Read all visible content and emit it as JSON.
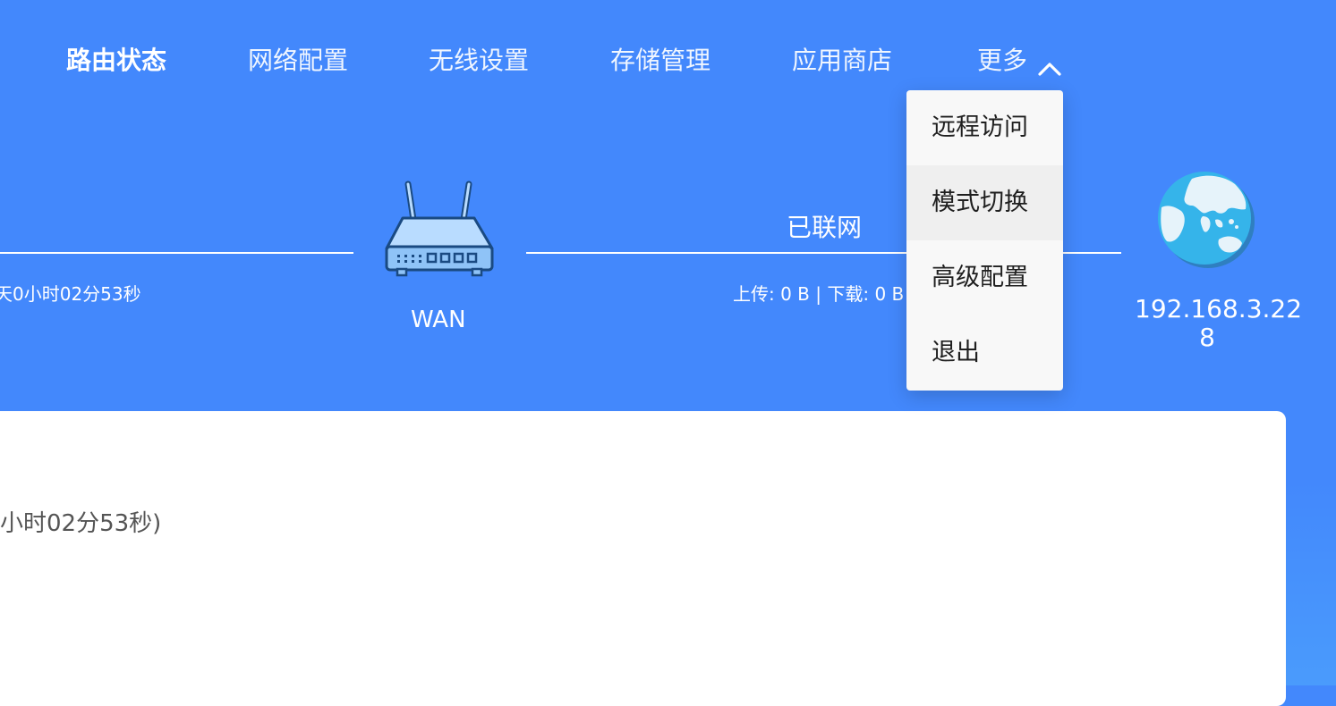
{
  "nav": {
    "items": [
      {
        "label": "路由状态",
        "active": true
      },
      {
        "label": "网络配置"
      },
      {
        "label": "无线设置"
      },
      {
        "label": "存储管理"
      },
      {
        "label": "应用商店"
      },
      {
        "label": "更多"
      }
    ]
  },
  "dropdown": {
    "items": [
      "远程访问",
      "模式切换",
      "高级配置",
      "退出"
    ],
    "hovered_index": 1
  },
  "status": {
    "left_uptime": "天0小时02分53秒",
    "wan_label": "WAN",
    "connection_state": "已联网",
    "traffic": "上传: 0 B  |  下载: 0 B",
    "ip_line1": "192.168.3.22",
    "ip_line2": "8"
  },
  "card": {
    "uptime_text": "小时02分53秒)"
  },
  "colors": {
    "background": "#4388fc",
    "dropdown_bg": "#f8f8f8",
    "dropdown_hover": "#efefef",
    "card_bg": "#ffffff"
  },
  "icons": {
    "router": "router-icon",
    "globe": "globe-icon",
    "more_toggle": "chevron-up-icon"
  }
}
